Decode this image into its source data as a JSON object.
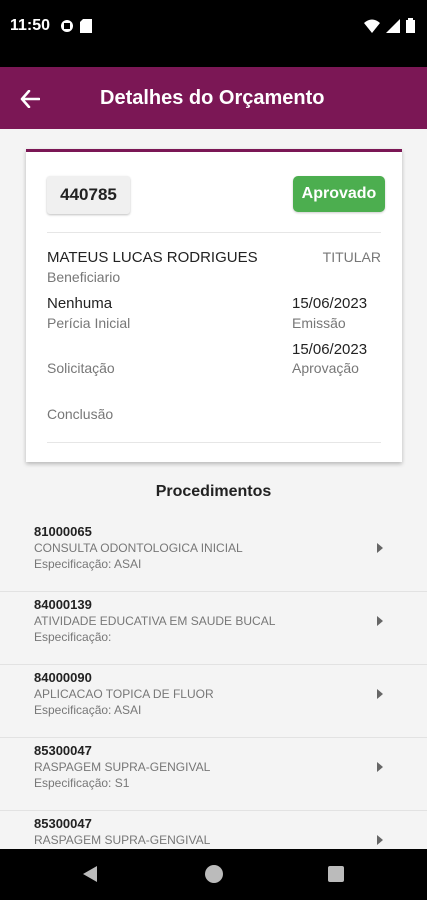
{
  "status_bar": {
    "time": "11:50"
  },
  "app_bar": {
    "title": "Detalhes do Orçamento"
  },
  "card": {
    "budget_number": "440785",
    "status": "Aprovado",
    "beneficiary_name": "MATEUS LUCAS RODRIGUES",
    "beneficiary_label": "Beneficiario",
    "holder_type": "TITULAR",
    "initial_expertise_value": "Nenhuma",
    "initial_expertise_label": "Perícia Inicial",
    "emission_date": "15/06/2023",
    "emission_label": "Emissão",
    "approval_date": "15/06/2023",
    "approval_label": "Aprovação",
    "request_label": "Solicitação",
    "conclusion_label": "Conclusão"
  },
  "procedures": {
    "title": "Procedimentos",
    "items": [
      {
        "code": "81000065",
        "name": "CONSULTA ODONTOLOGICA INICIAL",
        "spec": "Especificação: ASAI"
      },
      {
        "code": "84000139",
        "name": "ATIVIDADE EDUCATIVA EM SAUDE BUCAL",
        "spec": "Especificação:"
      },
      {
        "code": "84000090",
        "name": "APLICACAO TOPICA DE FLUOR",
        "spec": "Especificação: ASAI"
      },
      {
        "code": "85300047",
        "name": "RASPAGEM SUPRA-GENGIVAL",
        "spec": "Especificação: S1"
      },
      {
        "code": "85300047",
        "name": "RASPAGEM SUPRA-GENGIVAL",
        "spec": ""
      }
    ]
  },
  "colors": {
    "primary": "#7b1755",
    "approved": "#4cae4f"
  }
}
